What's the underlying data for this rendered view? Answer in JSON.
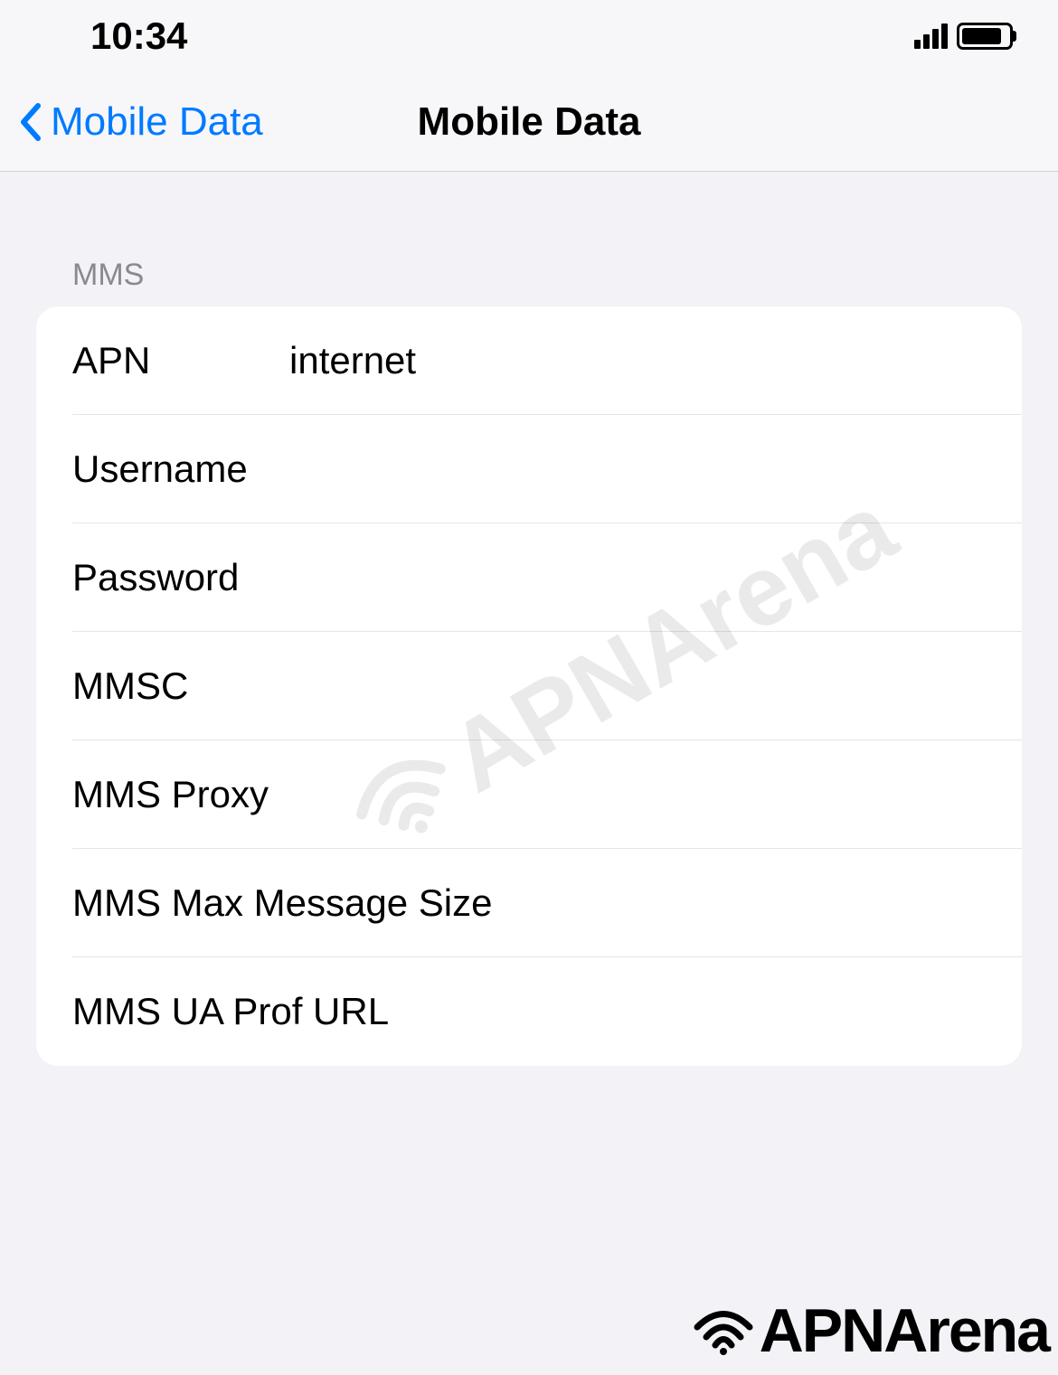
{
  "statusBar": {
    "time": "10:34"
  },
  "navBar": {
    "backLabel": "Mobile Data",
    "title": "Mobile Data"
  },
  "section": {
    "header": "MMS",
    "rows": [
      {
        "label": "APN",
        "value": "internet"
      },
      {
        "label": "Username",
        "value": ""
      },
      {
        "label": "Password",
        "value": ""
      },
      {
        "label": "MMSC",
        "value": ""
      },
      {
        "label": "MMS Proxy",
        "value": ""
      },
      {
        "label": "MMS Max Message Size",
        "value": ""
      },
      {
        "label": "MMS UA Prof URL",
        "value": ""
      }
    ]
  },
  "watermark": {
    "text": "APNArena"
  },
  "logo": {
    "text": "APNArena"
  }
}
